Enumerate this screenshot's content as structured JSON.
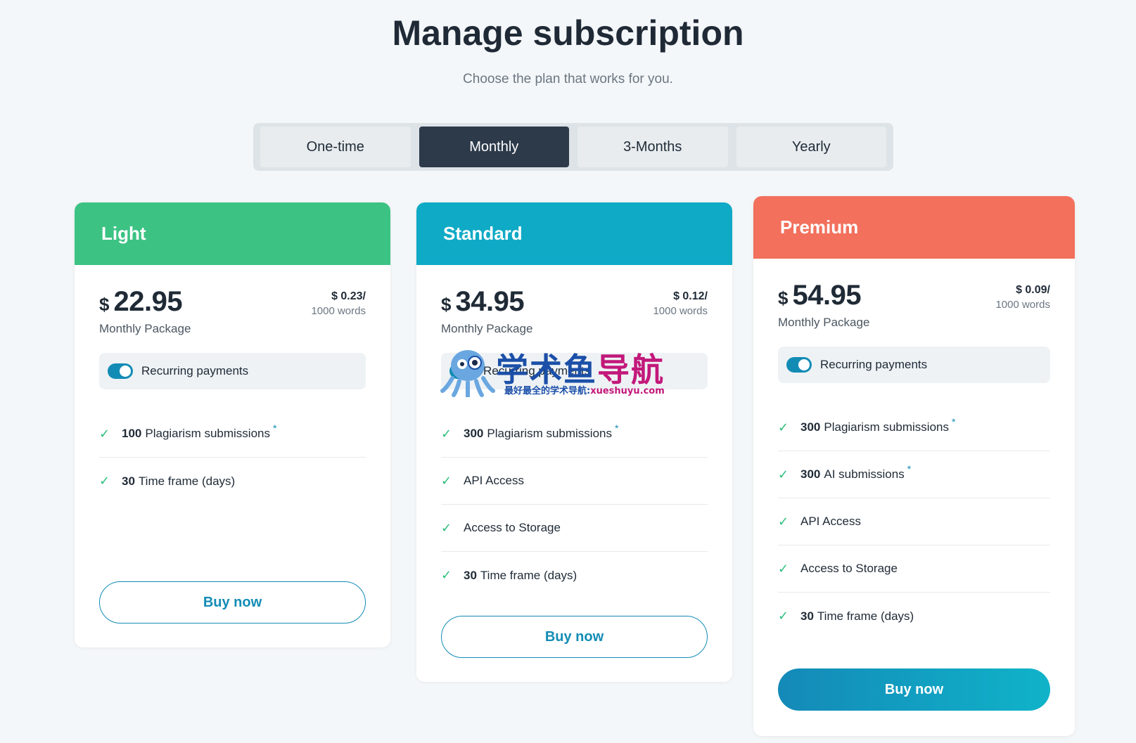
{
  "header": {
    "title": "Manage subscription",
    "subtitle": "Choose the plan that works for you."
  },
  "tabs": [
    {
      "label": "One-time",
      "active": false
    },
    {
      "label": "Monthly",
      "active": true
    },
    {
      "label": "3-Months",
      "active": false
    },
    {
      "label": "Yearly",
      "active": false
    }
  ],
  "colors": {
    "light": "#3cc384",
    "standard": "#0eaac6",
    "premium": "#f2705c",
    "accent": "#138cb5",
    "tab_active": "#2c3a4a"
  },
  "plans": [
    {
      "name": "Light",
      "currency": "$",
      "price": "22.95",
      "package": "Monthly Package",
      "unit_price": "$ 0.23/",
      "unit_words": "1000 words",
      "recurring_label": "Recurring payments",
      "features": [
        {
          "count": "100",
          "text": "Plagiarism submissions",
          "asterisk": "*"
        },
        {
          "count": "30",
          "text": "Time frame (days)",
          "asterisk": ""
        }
      ],
      "button": "Buy now"
    },
    {
      "name": "Standard",
      "currency": "$",
      "price": "34.95",
      "package": "Monthly Package",
      "unit_price": "$ 0.12/",
      "unit_words": "1000 words",
      "recurring_label": "Recurring payments",
      "features": [
        {
          "count": "300",
          "text": "Plagiarism submissions",
          "asterisk": "*"
        },
        {
          "count": "",
          "text": "API Access",
          "asterisk": ""
        },
        {
          "count": "",
          "text": "Access to Storage",
          "asterisk": ""
        },
        {
          "count": "30",
          "text": "Time frame (days)",
          "asterisk": ""
        }
      ],
      "button": "Buy now"
    },
    {
      "name": "Premium",
      "currency": "$",
      "price": "54.95",
      "package": "Monthly Package",
      "unit_price": "$ 0.09/",
      "unit_words": "1000 words",
      "recurring_label": "Recurring payments",
      "features": [
        {
          "count": "300",
          "text": "Plagiarism submissions",
          "asterisk": "*"
        },
        {
          "count": "300",
          "text": "AI submissions",
          "asterisk": "*"
        },
        {
          "count": "",
          "text": "API Access",
          "asterisk": ""
        },
        {
          "count": "",
          "text": "Access to Storage",
          "asterisk": ""
        },
        {
          "count": "30",
          "text": "Time frame (days)",
          "asterisk": ""
        }
      ],
      "button": "Buy now"
    }
  ],
  "watermark": {
    "title_a": "学术鱼",
    "title_b": "导航",
    "subtitle": "最好最全的学术导航:",
    "url": "xueshuyu.com"
  }
}
